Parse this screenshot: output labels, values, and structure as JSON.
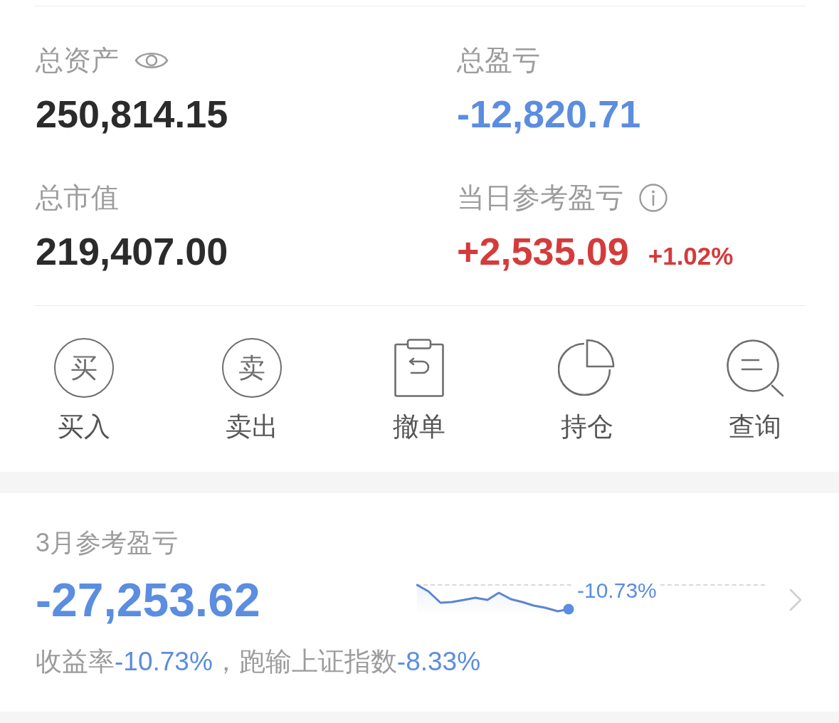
{
  "summary_card": {
    "stats": [
      {
        "label": "总资产",
        "eye_icon": true,
        "info_icon": false,
        "value": "250,814.15",
        "kind": "neutral"
      },
      {
        "label": "总盈亏",
        "eye_icon": false,
        "info_icon": false,
        "value": "-12,820.71",
        "kind": "loss"
      },
      {
        "label": "总市值",
        "eye_icon": false,
        "info_icon": false,
        "value": "219,407.00",
        "kind": "neutral"
      },
      {
        "label": "当日参考盈亏",
        "eye_icon": false,
        "info_icon": true,
        "value": "+2,535.09",
        "kind": "gain",
        "change": "+1.02%"
      }
    ]
  },
  "actions": [
    {
      "kind": "buy",
      "glyph": "买",
      "label": "买入"
    },
    {
      "kind": "sell",
      "glyph": "卖",
      "label": "卖出"
    },
    {
      "kind": "cancel",
      "label": "撤单"
    },
    {
      "kind": "positions",
      "label": "持仓"
    },
    {
      "kind": "query",
      "label": "查询"
    }
  ],
  "monthly_card": {
    "title": "3月参考盈亏",
    "value": "-27,253.62",
    "loss": true,
    "sparkline_label": "-10.73%",
    "summary": [
      {
        "text": "收益率",
        "kind": "text"
      },
      {
        "text": "-10.73%",
        "kind": "figure"
      },
      {
        "text": "，跑输上证指数",
        "kind": "text"
      },
      {
        "text": "-8.33%",
        "kind": "figure"
      }
    ]
  }
}
